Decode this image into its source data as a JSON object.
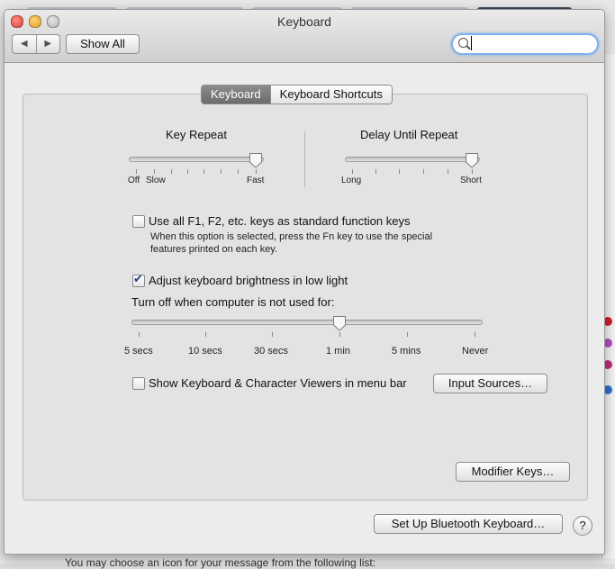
{
  "window": {
    "title": "Keyboard"
  },
  "toolbar": {
    "back_icon": "◀",
    "forward_icon": "▶",
    "show_all_label": "Show All",
    "search_value": "",
    "search_placeholder": ""
  },
  "tabs": [
    {
      "label": "Keyboard",
      "active": true
    },
    {
      "label": "Keyboard Shortcuts",
      "active": false
    }
  ],
  "key_repeat": {
    "title": "Key Repeat",
    "min_labels": [
      "Off",
      "Slow"
    ],
    "max_label": "Fast",
    "value_fraction": 1.0
  },
  "delay_until_repeat": {
    "title": "Delay Until Repeat",
    "min_label": "Long",
    "max_label": "Short",
    "value_fraction": 1.0
  },
  "function_keys": {
    "label": "Use all F1, F2, etc. keys as standard function keys",
    "checked": false,
    "help_line1": "When this option is selected, press the Fn key to use the special",
    "help_line2": "features printed on each key."
  },
  "brightness": {
    "label": "Adjust keyboard brightness in low light",
    "checked": true,
    "turn_off_label": "Turn off when computer is not used for:",
    "stops": [
      "5 secs",
      "10 secs",
      "30 secs",
      "1 min",
      "5 mins",
      "Never"
    ],
    "selected": "1 min"
  },
  "viewers": {
    "label": "Show Keyboard & Character Viewers in menu bar",
    "checked": false
  },
  "buttons": {
    "input_sources": "Input Sources…",
    "modifier_keys": "Modifier Keys…",
    "bluetooth": "Set Up Bluetooth Keyboard…",
    "help": "?"
  },
  "background": {
    "bottom_text": "You may choose an icon for your message from the following list:"
  }
}
